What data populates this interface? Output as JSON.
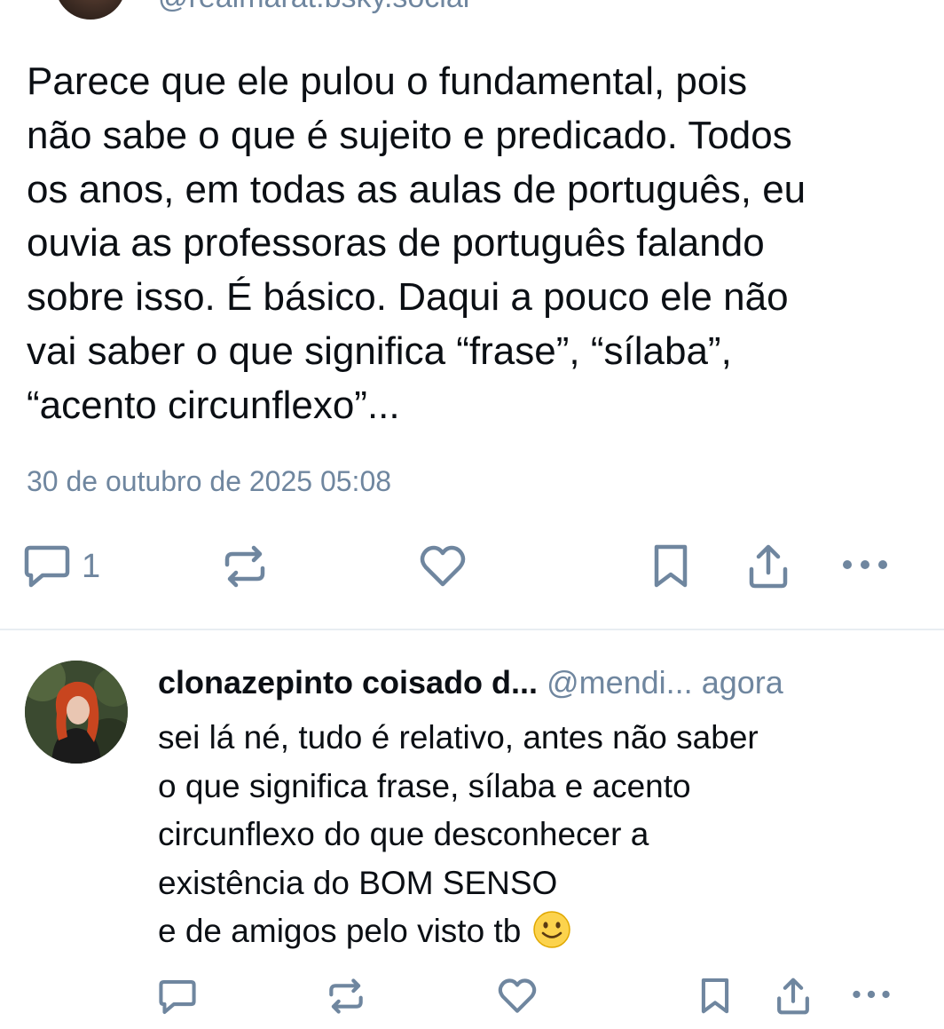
{
  "top_post": {
    "handle": "@realmarat.bsky.social",
    "text_lines": [
      "Parece que ele pulou o fundamental, pois",
      "não sabe o que é sujeito e predicado. Todos",
      "os anos, em todas as aulas de português, eu",
      "ouvia as professoras de português falando",
      "sobre isso. É básico. Daqui a pouco ele não",
      "vai saber o que significa “frase”, “sílaba”,",
      "“acento circunflexo”..."
    ],
    "date": "30 de outubro de 2025 05:08",
    "reply_count": "1",
    "icons": [
      "reply-icon",
      "repost-icon",
      "like-icon",
      "bookmark-icon",
      "share-icon",
      "more-icon"
    ]
  },
  "reply": {
    "display_name": "clonazepinto coisado d...",
    "handle": "@mendi...",
    "time": "agora",
    "text_lines": [
      "sei lá né, tudo é relativo, antes não saber",
      "o que significa frase, sílaba e acento",
      "circunflexo do que desconhecer a",
      "existência do BOM SENSO",
      "e de amigos pelo visto tb"
    ],
    "emoji": "slightly-smiling-face-emoji",
    "icons": [
      "reply-icon",
      "repost-icon",
      "like-icon",
      "bookmark-icon",
      "share-icon",
      "more-icon"
    ]
  },
  "colors": {
    "text": "#0b0f14",
    "muted": "#6f869f",
    "icon": "#6f869f",
    "divider": "#e8edf2",
    "background": "#ffffff"
  }
}
